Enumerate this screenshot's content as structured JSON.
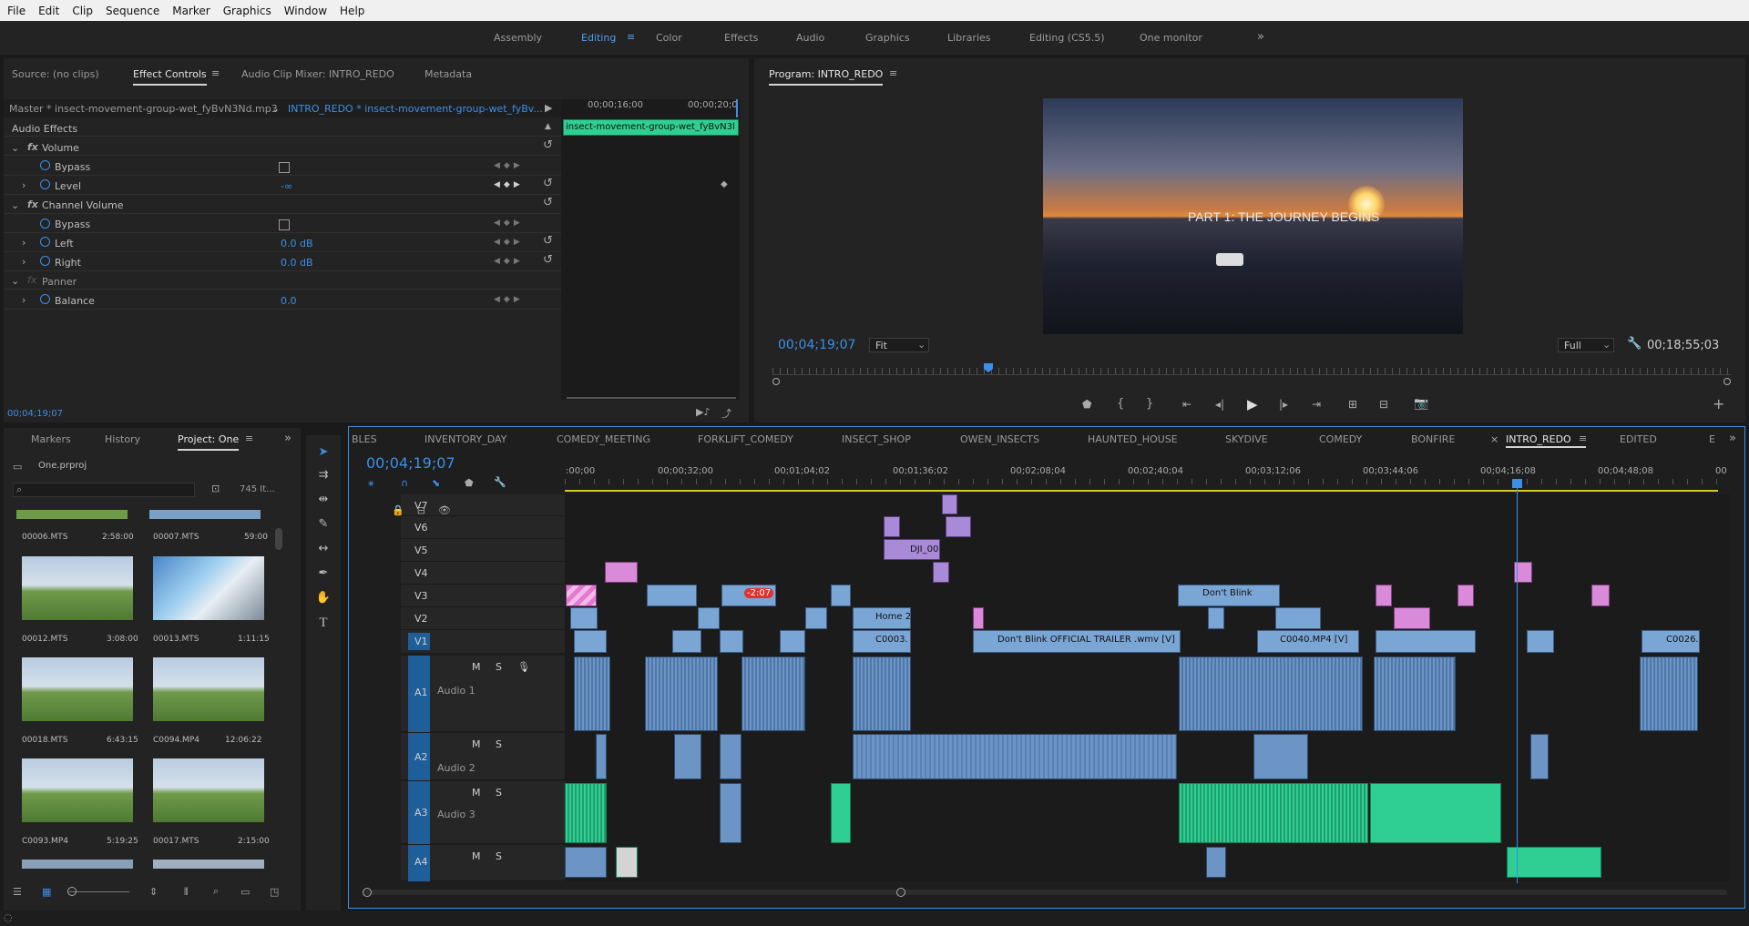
{
  "menu": [
    "File",
    "Edit",
    "Clip",
    "Sequence",
    "Marker",
    "Graphics",
    "Window",
    "Help"
  ],
  "workspaces": [
    {
      "label": "Assembly",
      "active": false
    },
    {
      "label": "Editing",
      "active": true
    },
    {
      "label": "Color",
      "active": false
    },
    {
      "label": "Effects",
      "active": false
    },
    {
      "label": "Audio",
      "active": false
    },
    {
      "label": "Graphics",
      "active": false
    },
    {
      "label": "Libraries",
      "active": false
    },
    {
      "label": "Editing (CS5.5)",
      "active": false
    },
    {
      "label": "One monitor",
      "active": false
    }
  ],
  "source_panel": {
    "tabs": [
      "Source: (no clips)",
      "Effect Controls",
      "Audio Clip Mixer: INTRO_REDO",
      "Metadata"
    ],
    "master": "Master * insect-movement-group-wet_fyBvN3Nd.mp3",
    "sequence_clip": "INTRO_REDO * insect-movement-group-wet_fyBv...",
    "mini_time_1": "00;00;16;00",
    "mini_time_2": "00;00;20;0",
    "mini_clip": "insect-movement-group-wet_fyBvN3l",
    "section": "Audio Effects",
    "volume": "Volume",
    "bypass": "Bypass",
    "level": "Level",
    "level_value": "-∞",
    "channel_volume": "Channel Volume",
    "left": "Left",
    "left_value": "0.0 dB",
    "right": "Right",
    "right_value": "0.0 dB",
    "panner": "Panner",
    "balance": "Balance",
    "balance_value": "0.0",
    "timecode": "00;04;19;07"
  },
  "program": {
    "title": "Program: INTRO_REDO",
    "overlay": "PART 1: THE JOURNEY BEGINS",
    "timecode": "00;04;19;07",
    "fit": "Fit",
    "quality": "Full",
    "duration": "00;18;55;03"
  },
  "project": {
    "tabs": [
      "Markers",
      "History",
      "Project: One"
    ],
    "file": "One.prproj",
    "count": "745 It...",
    "items": [
      {
        "name": "00006.MTS",
        "dur": "2:58:00"
      },
      {
        "name": "00007.MTS",
        "dur": "59:00"
      },
      {
        "name": "00012.MTS",
        "dur": "3:08:00"
      },
      {
        "name": "00013.MTS",
        "dur": "1:11:15"
      },
      {
        "name": "00018.MTS",
        "dur": "6:43:15"
      },
      {
        "name": "C0094.MP4",
        "dur": "12:06:22"
      },
      {
        "name": "C0093.MP4",
        "dur": "5:19:25"
      },
      {
        "name": "00017.MTS",
        "dur": "2:15:00"
      }
    ]
  },
  "timeline": {
    "tabs": [
      "BLES",
      "INVENTORY_DAY",
      "COMEDY_MEETING",
      "FORKLIFT_COMEDY",
      "INSECT_SHOP",
      "OWEN_INSECTS",
      "HAUNTED_HOUSE",
      "SKYDIVE",
      "COMEDY",
      "BONFIRE",
      "INTRO_REDO",
      "EDITED",
      "E"
    ],
    "active_tab": "INTRO_REDO",
    "timecode": "00;04;19;07",
    "ruler": [
      ":00;00",
      "00;00;32;00",
      "00;01;04;02",
      "00;01;36;02",
      "00;02;08;04",
      "00;02;40;04",
      "00;03;12;06",
      "00;03;44;06",
      "00;04;16;08",
      "00;04;48;08",
      "00"
    ],
    "video_tracks": [
      "V7",
      "V6",
      "V5",
      "V4",
      "V3",
      "V2",
      "V1"
    ],
    "audio_tracks": [
      {
        "id": "A1",
        "name": "Audio 1"
      },
      {
        "id": "A2",
        "name": "Audio 2"
      },
      {
        "id": "A3",
        "name": "Audio 3"
      },
      {
        "id": "A4",
        "name": ""
      }
    ],
    "track_buttons": {
      "mute": "M",
      "solo": "S"
    },
    "clip_labels": {
      "dji": "DJI_00",
      "dont_blink": "Don't Blink",
      "home": "Home 2",
      "c0003": "C0003.",
      "trailer": "Don't Blink OFFICIAL TRAILER .wmv [V]",
      "c0040": "C0040.MP4 [V]",
      "c0026": "C0026.",
      "speed": "-2:07"
    }
  },
  "colors": {
    "accent": "#3d8ee6",
    "video_clip": "#7aa6d6",
    "audio_clip": "#6c94c4",
    "graphic_clip": "#d98ad8",
    "green_audio": "#2fcf93"
  }
}
